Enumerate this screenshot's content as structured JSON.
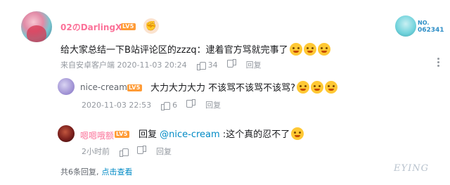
{
  "main_comment": {
    "username": "02のDarlingXX",
    "level": "LV5",
    "content": "给大家总结一下B站评论区的zzzq：逮着官方骂就完事了",
    "timestamp": "来自安卓客户端   2020-11-03 20:24",
    "likes": "34",
    "reply_label": "回复",
    "medal_label": "NO.",
    "medal_number": "062341"
  },
  "replies": [
    {
      "username": "nice-cream",
      "level": "LV5",
      "content": "大力大力大力  不该骂不该骂不该骂?",
      "timestamp": "2020-11-03 22:53",
      "likes": "6",
      "reply_label": "回复"
    },
    {
      "username": "嗯嗯哦额",
      "level": "LV5",
      "reply_prefix": "回复",
      "mention": "@nice-cream",
      "content": ":这个真的忍不了",
      "timestamp": "2小时前",
      "likes": "",
      "reply_label": "回复"
    }
  ],
  "footer": {
    "count_text": "共6条回复,",
    "view_link": "点击查看"
  },
  "watermark": "EYING",
  "colors": {
    "username_vip": "#fb7299",
    "link_blue": "#008ac5",
    "meta_gray": "#9499a0",
    "level_badge": "#ff9b36"
  }
}
